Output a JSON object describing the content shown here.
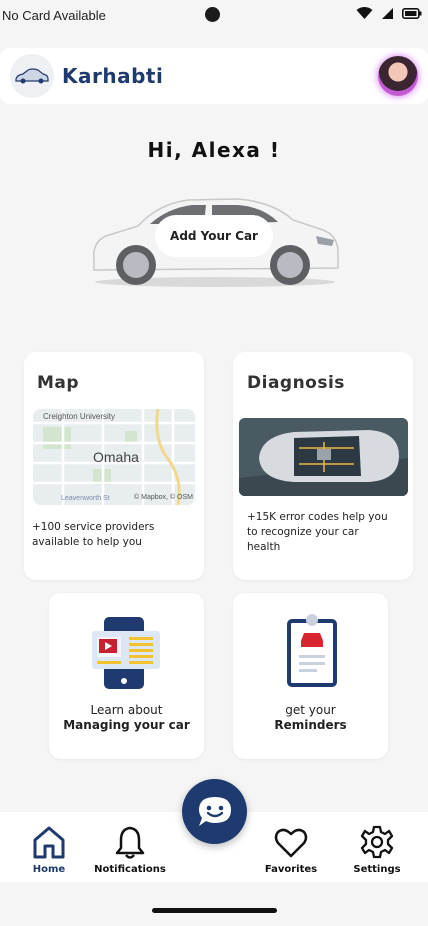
{
  "status_bar": {
    "carrier": "No Card Available"
  },
  "app_bar": {
    "brand": "Karhabti"
  },
  "greeting": "Hi, Alexa !",
  "add_car_label": "Add Your Car",
  "cards": {
    "map": {
      "title": "Map",
      "desc_line1": "+100 service providers",
      "desc_line2": "available to help you",
      "map_city": "Omaha",
      "map_top_label": "Creighton University",
      "map_bottom_label": "Leavenworth St",
      "map_attribution": "© Mapbox, © OSM"
    },
    "diagnosis": {
      "title": "Diagnosis",
      "desc_line1": "+15K error codes help you",
      "desc_line2": "to recognize your car",
      "desc_line3": "health"
    },
    "learn": {
      "line1": "Learn about",
      "line2": "Managing your car"
    },
    "reminders": {
      "line1": "get your",
      "line2": "Reminders"
    }
  },
  "bottom_nav": {
    "items": [
      {
        "label": "Home",
        "icon": "home-icon",
        "active": true
      },
      {
        "label": "Notifications",
        "icon": "bell-icon"
      },
      {
        "label": "Favorites",
        "icon": "heart-icon"
      },
      {
        "label": "Settings",
        "icon": "gear-icon"
      }
    ]
  },
  "colors": {
    "brand": "#1f3a6e",
    "background": "#f5f5f5",
    "card": "#ffffff"
  }
}
